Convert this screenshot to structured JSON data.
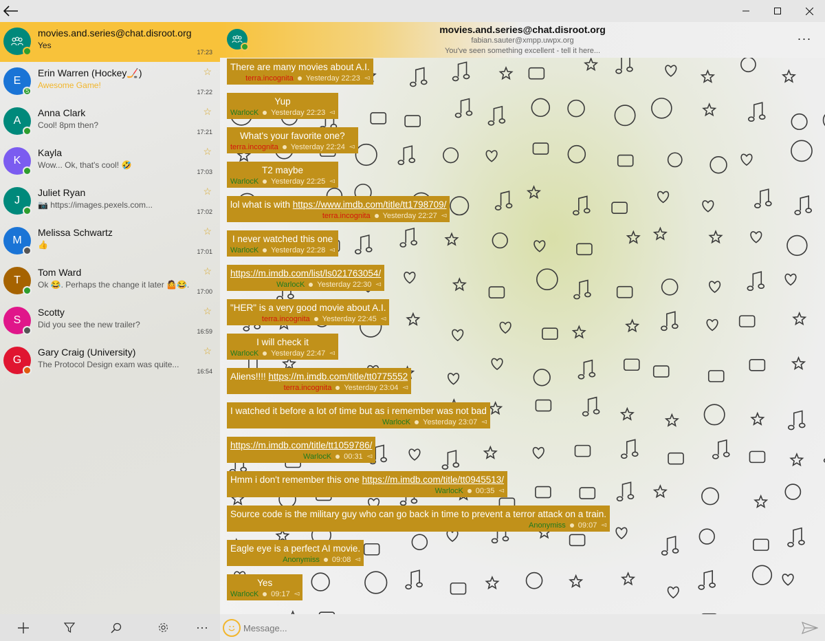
{
  "window": {
    "back_icon": "arrow-left-icon",
    "minimize_icon": "minimize-icon",
    "maximize_icon": "maximize-icon",
    "close_icon": "close-icon"
  },
  "sidebar": {
    "chats": [
      {
        "initial": "",
        "name": "movies.and.series@chat.disroot.org",
        "preview": "Yes",
        "time": "17:23",
        "starred": false,
        "avatar_color": "#00897b",
        "presence_color": "#2e9e2e",
        "active": true,
        "group": true
      },
      {
        "initial": "E",
        "name": "Erin Warren (Hockey🏒)",
        "preview": "Awesome Game!",
        "time": "17:22",
        "starred": true,
        "avatar_color": "#1a74d6",
        "presence_color": "#2e9e2e",
        "preview_color": "#f2b62c",
        "presence_letter": "S"
      },
      {
        "initial": "A",
        "name": "Anna Clark",
        "preview": "Cool! 8pm then?",
        "time": "17:21",
        "starred": true,
        "avatar_color": "#00897b",
        "presence_color": "#2e9e2e"
      },
      {
        "initial": "K",
        "name": "Kayla",
        "preview": "Wow... Ok, that's cool! 🤣",
        "time": "17:03",
        "starred": true,
        "avatar_color": "#7b5cf0",
        "presence_color": "#2e9e2e"
      },
      {
        "initial": "J",
        "name": "Juliet Ryan",
        "preview": "📷 https://images.pexels.com...",
        "time": "17:02",
        "starred": true,
        "avatar_color": "#00897b",
        "presence_color": "#2e9e2e"
      },
      {
        "initial": "M",
        "name": "Melissa Schwartz",
        "preview": "👍",
        "time": "17:01",
        "starred": true,
        "avatar_color": "#1a74d6",
        "presence_color": "#555555"
      },
      {
        "initial": "T",
        "name": "Tom Ward",
        "preview": "Ok 😂. Perhaps the change it later 🤷😂.",
        "time": "17:00",
        "starred": true,
        "avatar_color": "#a66300",
        "presence_color": "#2e9e2e"
      },
      {
        "initial": "S",
        "name": "Scotty",
        "preview": "Did you see the new trailer?",
        "time": "16:59",
        "starred": true,
        "avatar_color": "#e0168a",
        "presence_color": "#555555"
      },
      {
        "initial": "G",
        "name": "Gary Craig (University)",
        "preview": "The Protocol Design exam was quite...",
        "time": "16:54",
        "starred": true,
        "avatar_color": "#e01530",
        "presence_color": "#e05a10"
      }
    ],
    "toolbar": {
      "add_icon": "plus-icon",
      "filter_icon": "filter-icon",
      "search_icon": "search-icon",
      "settings_icon": "gear-icon",
      "more_label": "···"
    }
  },
  "chat": {
    "title": "movies.and.series@chat.disroot.org",
    "subtitle": "fabian.sauter@xmpp.uwpx.org",
    "status": "You've seen something excellent - tell it here...",
    "more_label": "···",
    "messages": [
      {
        "parts": [
          {
            "t": "There are many movies about A.I."
          }
        ],
        "sender": "terra.incognita",
        "sender_color": "red",
        "time": "Yesterday 22:23"
      },
      {
        "parts": [
          {
            "t": "Yup"
          }
        ],
        "sender": "WarlocK",
        "sender_color": "green",
        "time": "Yesterday 22:23"
      },
      {
        "parts": [
          {
            "t": "What's your favorite one?"
          }
        ],
        "sender": "terra.incognita",
        "sender_color": "red",
        "time": "Yesterday 22:24"
      },
      {
        "parts": [
          {
            "t": "T2 maybe"
          }
        ],
        "sender": "WarlocK",
        "sender_color": "green",
        "time": "Yesterday 22:25"
      },
      {
        "parts": [
          {
            "t": "lol what is with "
          },
          {
            "link": "https://www.imdb.com/title/tt1798709/"
          }
        ],
        "sender": "terra.incognita",
        "sender_color": "red",
        "time": "Yesterday 22:27"
      },
      {
        "parts": [
          {
            "t": "I never watched this one"
          }
        ],
        "sender": "WarlocK",
        "sender_color": "green",
        "time": "Yesterday 22:28"
      },
      {
        "parts": [
          {
            "link": "https://m.imdb.com/list/ls021763054/"
          }
        ],
        "sender": "WarlocK",
        "sender_color": "green",
        "time": "Yesterday 22:30"
      },
      {
        "parts": [
          {
            "t": "\"HER\" is a very good movie about A.I."
          }
        ],
        "sender": "terra.incognita",
        "sender_color": "red",
        "time": "Yesterday 22:45"
      },
      {
        "parts": [
          {
            "t": "I will check it"
          }
        ],
        "sender": "WarlocK",
        "sender_color": "green",
        "time": "Yesterday 22:47"
      },
      {
        "parts": [
          {
            "t": "Aliens!!!! "
          },
          {
            "link": "https://m.imdb.com/title/tt0775552"
          }
        ],
        "sender": "terra.incognita",
        "sender_color": "red",
        "time": "Yesterday 23:04"
      },
      {
        "parts": [
          {
            "t": "I watched it before a lot of time but as i remember was not bad"
          }
        ],
        "sender": "WarlocK",
        "sender_color": "green",
        "time": "Yesterday 23:07"
      },
      {
        "parts": [
          {
            "link": "https://m.imdb.com/title/tt1059786/"
          }
        ],
        "sender": "WarlocK",
        "sender_color": "green",
        "time": "00:31"
      },
      {
        "parts": [
          {
            "t": "Hmm i don't remember this one "
          },
          {
            "link": "https://m.imdb.com/title/tt0945513/"
          }
        ],
        "sender": "WarlocK",
        "sender_color": "green",
        "time": "00:35"
      },
      {
        "parts": [
          {
            "t": "Source code is the military guy who can go back in time to prevent a terror attack on a train."
          }
        ],
        "sender": "Anonymiss",
        "sender_color": "green",
        "time": "09:07"
      },
      {
        "parts": [
          {
            "t": "Eagle eye is a perfect AI movie."
          }
        ],
        "sender": "Anonymiss",
        "sender_color": "green",
        "time": "09:08"
      },
      {
        "parts": [
          {
            "t": "Yes"
          }
        ],
        "sender": "WarlocK",
        "sender_color": "green",
        "time": "09:17"
      }
    ],
    "composer": {
      "placeholder": "Message...",
      "emoji_icon": "smiley-icon",
      "send_icon": "send-icon"
    }
  },
  "colors": {
    "accent": "#f8c23a",
    "bubble": "#c1911a",
    "sender_red": "#d4170b",
    "sender_green": "#1f7a1f"
  }
}
